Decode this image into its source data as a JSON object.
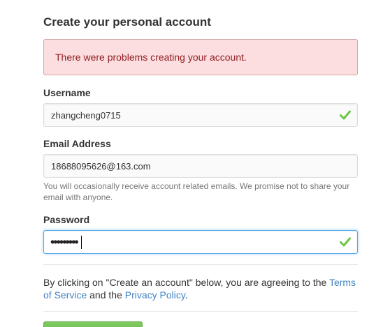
{
  "form": {
    "title": "Create your personal account",
    "error_message": "There were problems creating your account.",
    "username": {
      "label": "Username",
      "value": "zhangcheng0715",
      "valid": true
    },
    "email": {
      "label": "Email Address",
      "value": "18688095626@163.com",
      "note": "You will occasionally receive account related emails. We promise not to share your email with anyone."
    },
    "password": {
      "label": "Password",
      "masked_value": "•••••••••",
      "valid": true
    },
    "terms": {
      "prefix": "By clicking on \"Create an account\" below, you are agreeing to the ",
      "terms_link": "Terms of Service",
      "middle": " and the ",
      "privacy_link": "Privacy Policy",
      "suffix": "."
    }
  },
  "colors": {
    "error_background": "#fcdee0",
    "error_text": "#911e22",
    "link": "#4183c4",
    "valid_check": "#6cc644",
    "focus_border": "#51a7e8",
    "submit_green": "#60b044"
  },
  "icons": {
    "valid": "check-icon"
  }
}
